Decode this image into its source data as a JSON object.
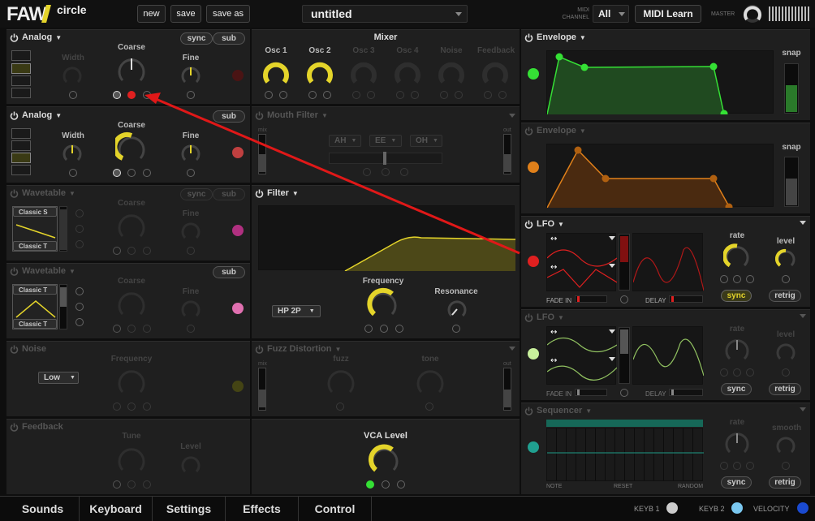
{
  "app": {
    "logo_main": "FAW",
    "logo_sub": "circle"
  },
  "toolbar": {
    "new": "new",
    "save": "save",
    "save_as": "save as",
    "preset": "untitled",
    "midi_label": "MIDI\nCHANNEL",
    "midi_value": "All",
    "midi_learn": "MIDI Learn",
    "master": "MASTER"
  },
  "osc1": {
    "title": "Analog",
    "sync": "sync",
    "sub": "sub",
    "width": "Width",
    "coarse": "Coarse",
    "fine": "Fine"
  },
  "osc2": {
    "title": "Analog",
    "sub": "sub",
    "width": "Width",
    "coarse": "Coarse",
    "fine": "Fine"
  },
  "osc3": {
    "title": "Wavetable",
    "sync": "sync",
    "sub": "sub",
    "coarse": "Coarse",
    "fine": "Fine",
    "table1": "Classic S",
    "table2": "Classic T"
  },
  "osc4": {
    "title": "Wavetable",
    "sub": "sub",
    "coarse": "Coarse",
    "fine": "Fine",
    "table1": "Classic T",
    "table2": "Classic T"
  },
  "noise": {
    "title": "Noise",
    "frequency": "Frequency",
    "mode": "Low"
  },
  "feedback": {
    "title": "Feedback",
    "tune": "Tune",
    "level": "Level"
  },
  "mixer": {
    "title": "Mixer",
    "channels": [
      "Osc 1",
      "Osc 2",
      "Osc 3",
      "Osc 4",
      "Noise",
      "Feedback"
    ]
  },
  "mouth": {
    "title": "Mouth Filter",
    "mix": "mix",
    "out": "out",
    "v1": "AH",
    "v2": "EE",
    "v3": "OH"
  },
  "filter": {
    "title": "Filter",
    "type": "HP 2P",
    "frequency": "Frequency",
    "resonance": "Resonance"
  },
  "fuzz": {
    "title": "Fuzz Distortion",
    "mix": "mix",
    "out": "out",
    "fuzz": "fuzz",
    "tone": "tone"
  },
  "vca": {
    "title": "VCA Level"
  },
  "env1": {
    "title": "Envelope",
    "snap": "snap",
    "color": "#35e035"
  },
  "env2": {
    "title": "Envelope",
    "snap": "snap",
    "color": "#e0801a"
  },
  "lfo1": {
    "title": "LFO",
    "rate": "rate",
    "level": "level",
    "fade_in": "FADE IN",
    "delay": "DELAY",
    "sync": "sync",
    "retrig": "retrig",
    "color": "#e02020"
  },
  "lfo2": {
    "title": "LFO",
    "rate": "rate",
    "level": "level",
    "fade_in": "FADE IN",
    "delay": "DELAY",
    "sync": "sync",
    "retrig": "retrig",
    "color": "#a8e070"
  },
  "seq": {
    "title": "Sequencer",
    "rate": "rate",
    "smooth": "smooth",
    "note": "NOTE",
    "reset": "RESET",
    "random": "RANDOM",
    "sync": "sync",
    "retrig": "retrig",
    "color": "#20a090"
  },
  "bottom": {
    "tabs": [
      "Sounds",
      "Keyboard",
      "Settings",
      "Effects",
      "Control"
    ],
    "keyb1": "KEYB 1",
    "keyb2": "KEYB 2",
    "velocity": "VELOCITY"
  }
}
